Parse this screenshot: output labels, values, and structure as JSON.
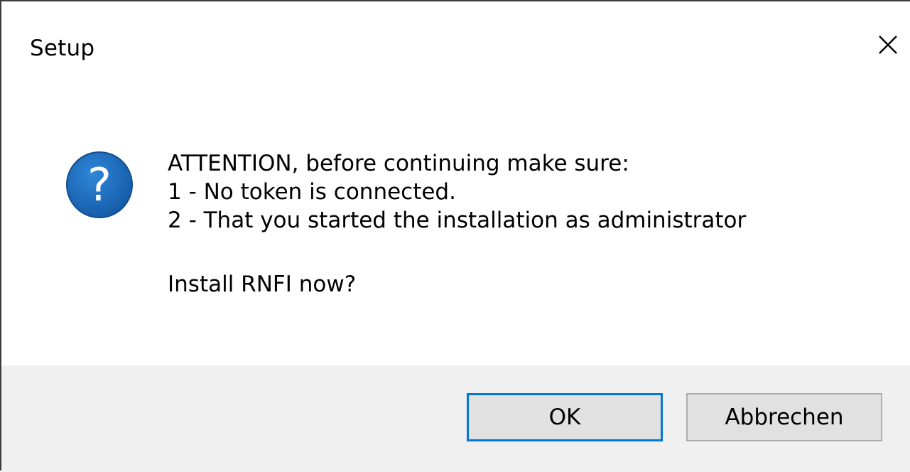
{
  "window": {
    "title": "Setup",
    "close_icon": "close-icon"
  },
  "message": {
    "icon": "question-icon",
    "lines": [
      "ATTENTION, before continuing make sure:",
      "1 - No token is connected.",
      "2 - That you started the installation as administrator"
    ],
    "question": "Install RNFI now?"
  },
  "buttons": {
    "ok_label": "OK",
    "cancel_label": "Abbrechen"
  },
  "colors": {
    "icon_blue": "#1c6fc2",
    "focus_border": "#0078d7",
    "footer_bg": "#f0f0f0",
    "button_bg": "#e1e1e1"
  }
}
